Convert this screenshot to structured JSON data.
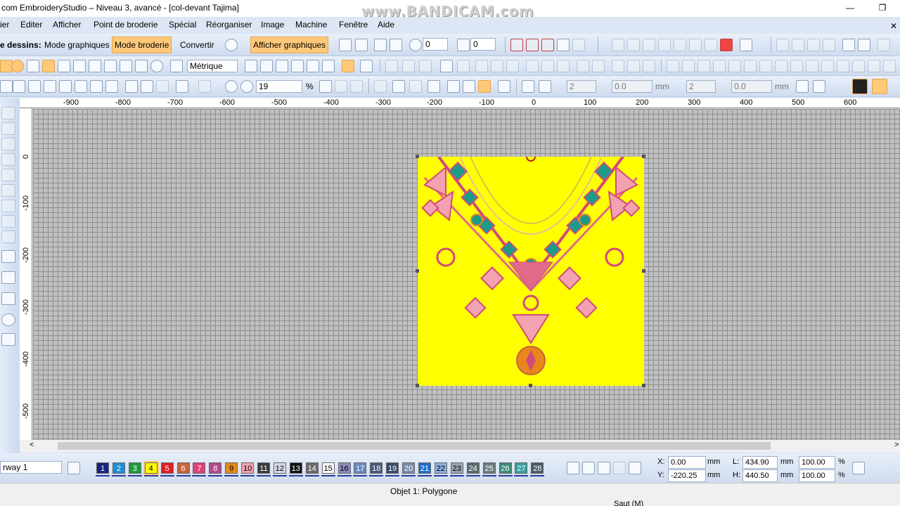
{
  "window": {
    "title": "com EmbroideryStudio – Niveau 3, avancé - [col-devant          Tajima]",
    "watermark": "www.BANDICAM.com"
  },
  "menu": [
    "ier",
    "Editer",
    "Afficher",
    "Point de broderie",
    "Spécial",
    "Réorganiser",
    "Image",
    "Machine",
    "Fenêtre",
    "Aide"
  ],
  "toolbar1": {
    "mode_label": "e dessins:",
    "graphics_mode": "Mode graphiques",
    "embroidery_mode": "Mode broderie",
    "convert": "Convertir",
    "show_graphics": "Afficher graphiques",
    "rotate_value": "0",
    "skew_value": "0"
  },
  "toolbar2": {
    "units": "Métrique",
    "units_options": [
      "Métrique"
    ]
  },
  "toolbar3": {
    "zoom_value": "19",
    "zoom_unit": "%",
    "spin1": "2",
    "spin2": "0.0",
    "spin2_unit": "mm",
    "spin3": "2",
    "spin4": "0.0",
    "spin4_unit": "mm"
  },
  "ruler_h": [
    "-900",
    "-800",
    "-700",
    "-600",
    "-500",
    "-400",
    "-300",
    "-200",
    "-100",
    "0",
    "100",
    "200",
    "300",
    "400",
    "500",
    "600"
  ],
  "ruler_v": [
    "0",
    "-100",
    "-200",
    "-300",
    "-400",
    "-500"
  ],
  "colorway": {
    "label": "rway 1"
  },
  "colors": [
    {
      "n": "1",
      "c": "#1a237e",
      "t": "#fff"
    },
    {
      "n": "2",
      "c": "#1f8fd4",
      "t": "#fff"
    },
    {
      "n": "3",
      "c": "#1e9a3a",
      "t": "#fff"
    },
    {
      "n": "4",
      "c": "#ffff00",
      "t": "#000"
    },
    {
      "n": "5",
      "c": "#e02020",
      "t": "#fff"
    },
    {
      "n": "6",
      "c": "#c8643c",
      "t": "#fff"
    },
    {
      "n": "7",
      "c": "#e0407a",
      "t": "#fff"
    },
    {
      "n": "8",
      "c": "#b04a8c",
      "t": "#fff"
    },
    {
      "n": "9",
      "c": "#e8871c",
      "t": "#000"
    },
    {
      "n": "10",
      "c": "#f2a2b0",
      "t": "#000"
    },
    {
      "n": "11",
      "c": "#3c3c3c",
      "t": "#fff"
    },
    {
      "n": "12",
      "c": "#d7d7e6",
      "t": "#000"
    },
    {
      "n": "13",
      "c": "#101010",
      "t": "#fff"
    },
    {
      "n": "14",
      "c": "#6a6a6a",
      "t": "#fff"
    },
    {
      "n": "15",
      "c": "#ffffff",
      "t": "#000"
    },
    {
      "n": "16",
      "c": "#8a8abe",
      "t": "#000"
    },
    {
      "n": "17",
      "c": "#6a8ac0",
      "t": "#fff"
    },
    {
      "n": "18",
      "c": "#4a5a7a",
      "t": "#fff"
    },
    {
      "n": "19",
      "c": "#3a4a6a",
      "t": "#fff"
    },
    {
      "n": "20",
      "c": "#7a8aaa",
      "t": "#fff"
    },
    {
      "n": "21",
      "c": "#1e6ec8",
      "t": "#fff"
    },
    {
      "n": "22",
      "c": "#8ab0e0",
      "t": "#000"
    },
    {
      "n": "23",
      "c": "#9aa6b6",
      "t": "#000"
    },
    {
      "n": "24",
      "c": "#5a6a70",
      "t": "#fff"
    },
    {
      "n": "25",
      "c": "#6a7a80",
      "t": "#fff"
    },
    {
      "n": "26",
      "c": "#3a8a7a",
      "t": "#fff"
    },
    {
      "n": "27",
      "c": "#3aa0a0",
      "t": "#fff"
    },
    {
      "n": "28",
      "c": "#4a5a66",
      "t": "#fff"
    }
  ],
  "coords": {
    "x_label": "X:",
    "x": "0.00",
    "x_unit": "mm",
    "y_label": "Y:",
    "y": "-220.25",
    "y_unit": "mm",
    "l_label": "L:",
    "l": "434.90",
    "l_unit": "mm",
    "h_label": "H:",
    "h": "440.50",
    "h_unit": "mm",
    "sx": "100.00",
    "sx_unit": "%",
    "sy": "100.00",
    "sy_unit": "%"
  },
  "status": {
    "object": "Objet 1: Polygone",
    "stitch": "Saut (M)"
  },
  "accent_color": "#ffc97a",
  "design_background": "#ffff00"
}
